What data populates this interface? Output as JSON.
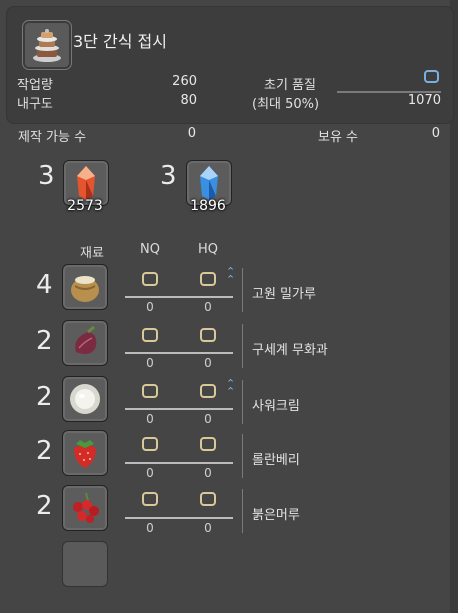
{
  "item": {
    "name": "3단 간식 접시",
    "icon": "snack-plate-icon"
  },
  "stats": {
    "progress_label": "작업량",
    "progress_value": "260",
    "durability_label": "내구도",
    "durability_value": "80",
    "initial_quality_label": "초기 품질",
    "max_label": "(최대 50%)",
    "quality_value": "1070"
  },
  "craftable": {
    "label": "제작 가능 수",
    "value": "0"
  },
  "owned": {
    "label": "보유 수",
    "value": "0"
  },
  "crystals": [
    {
      "required": "3",
      "count": "2573",
      "icon": "fire-crystal-icon"
    },
    {
      "required": "3",
      "count": "1896",
      "icon": "water-crystal-icon"
    }
  ],
  "columns": {
    "material": "재료",
    "nq": "NQ",
    "hq": "HQ"
  },
  "ingredients": [
    {
      "required": "4",
      "name": "고원 밀가루",
      "nq_count": "0",
      "hq_count": "0",
      "hq_marker": true,
      "icon": "flour-sack-icon"
    },
    {
      "required": "2",
      "name": "구세계 무화과",
      "nq_count": "0",
      "hq_count": "0",
      "hq_marker": false,
      "icon": "fig-icon"
    },
    {
      "required": "2",
      "name": "사워크림",
      "nq_count": "0",
      "hq_count": "0",
      "hq_marker": true,
      "icon": "sour-cream-icon"
    },
    {
      "required": "2",
      "name": "롤란베리",
      "nq_count": "0",
      "hq_count": "0",
      "hq_marker": false,
      "icon": "strawberry-icon"
    },
    {
      "required": "2",
      "name": "붉은머루",
      "nq_count": "0",
      "hq_count": "0",
      "hq_marker": false,
      "icon": "red-berries-icon"
    }
  ]
}
